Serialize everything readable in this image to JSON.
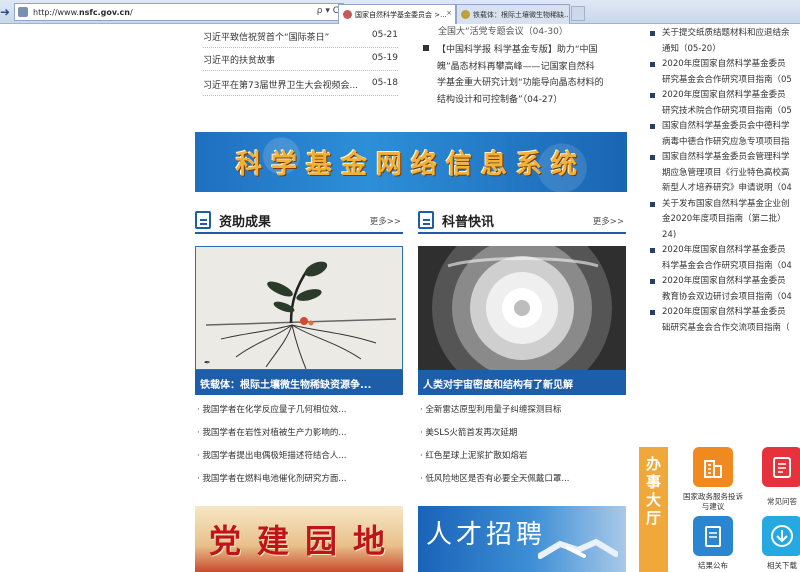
{
  "browser": {
    "url_prefix": "http://www.",
    "url_domain": "nsfc.gov.cn",
    "url_suffix": "/",
    "address_tools": "ρ ▾ C",
    "tabs": [
      {
        "label": "国家自然科学基金委员会 >...",
        "close": "×"
      },
      {
        "label": "铁载体：根际土壤微生物稀缺..."
      }
    ]
  },
  "news_list": [
    {
      "title": "习近平致信祝贺首个“国际茶日”",
      "date": "05-21"
    },
    {
      "title": "习近平的扶贫故事",
      "date": "05-19"
    },
    {
      "title": "习近平在第73届世界卫生大会视频会...",
      "date": "05-18"
    }
  ],
  "middle": {
    "top_partial": "全国大“活党专题会议（04-30）",
    "item_text": "【中国科学报 科学基金专版】助力“中国魄”晶态材料再攀高峰——记国家自然科学基金重大研究计划“功能导向晶态材料的结构设计和可控制备”（04-27）",
    "item_lines": [
      "【中国科学报 科学基金专版】助力“中国",
      "魄”晶态材料再攀高峰——记国家自然科",
      "学基金重大研究计划“功能导向晶态材料的",
      "结构设计和可控制备”（04-27）"
    ]
  },
  "right_list": [
    {
      "lines": [
        "关于提交纸质结题材料和应退结余",
        "通知（05-20）"
      ]
    },
    {
      "lines": [
        "2020年度国家自然科学基金委员",
        "研究基金会合作研究项目指南（05"
      ]
    },
    {
      "lines": [
        "2020年度国家自然科学基金委员",
        "研究技术院合作研究项目指南（05"
      ]
    },
    {
      "lines": [
        "国家自然科学基金委员会中德科学",
        "病毒中德合作研究应急专项项目指"
      ]
    },
    {
      "lines": [
        "国家自然科学基金委员会管理科学",
        "期应急管理项目《行业特色高校高",
        "新型人才培养研究》申请说明（04"
      ]
    },
    {
      "lines": [
        "关于发布国家自然科学基金企业创",
        "金2020年度项目指南（第二批）",
        "24)"
      ]
    },
    {
      "lines": [
        "2020年度国家自然科学基金委员",
        "科学基金会合作研究项目指南（04"
      ]
    },
    {
      "lines": [
        "2020年度国家自然科学基金委员",
        "教育协会双边研讨会项目指南（04"
      ]
    },
    {
      "lines": [
        "2020年度国家自然科学基金委员",
        "础研究基金会合作交流项目指南（"
      ]
    }
  ],
  "banner": {
    "text": "科学基金网络信息系统"
  },
  "sections": {
    "left": {
      "title": "资助成果",
      "more": "更多>>",
      "caption": "铁载体：根际土壤微生物稀缺资源争...",
      "items": [
        "· 我国学者在化学反应量子几何相位效...",
        "· 我国学者在岩性对植被生产力影响的...",
        "· 我国学者提出电偶极矩描述符结合人...",
        "· 我国学者在燃料电池催化剂研究方面..."
      ]
    },
    "right": {
      "title": "科普快讯",
      "more": "更多>>",
      "caption": "人类对宇宙密度和结构有了新见解",
      "items": [
        "· 全新雷达原型利用量子纠缠探测目标",
        "· 美SLS火箭首发再次延期",
        "· 红色星球上泥浆扩散如熔岩",
        "· 低风险地区是否有必要全天佩戴口罩..."
      ]
    }
  },
  "promos": {
    "left": "党建园地",
    "right": "人才招聘"
  },
  "service_hall": {
    "title_chars": [
      "办",
      "事",
      "大",
      "厅"
    ],
    "items": [
      {
        "label": "国家政务服务投诉与建议",
        "icon": "building-icon"
      },
      {
        "label": "常见问答",
        "icon": "notepad-icon"
      },
      {
        "label": "结果公布",
        "icon": "document-icon"
      },
      {
        "label": "相关下载",
        "icon": "download-icon"
      }
    ]
  },
  "colors": {
    "accent_blue": "#1e5ea8",
    "banner_text": "#f2b23a",
    "hall_orange": "#f0a83a"
  }
}
